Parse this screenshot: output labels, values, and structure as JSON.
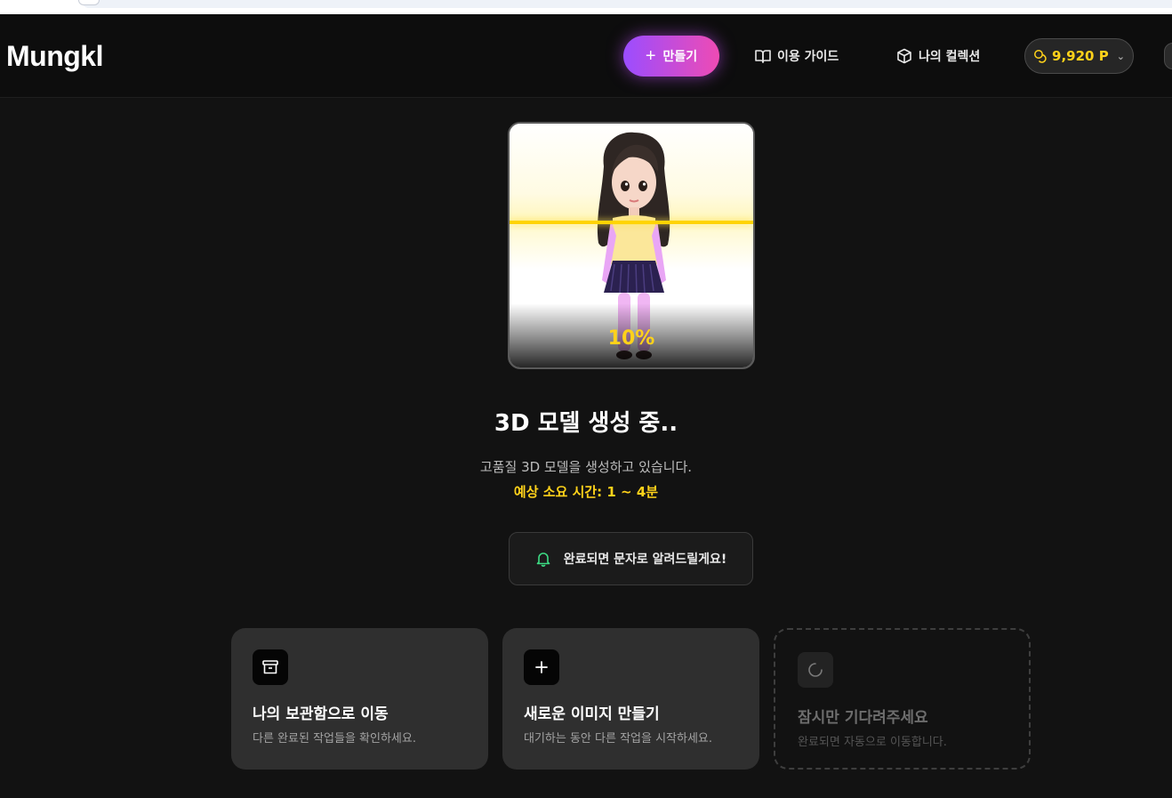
{
  "header": {
    "logo": "Mungkl",
    "create_label": "만들기",
    "guide_label": "이용 가이드",
    "collection_label": "나의 컬렉션",
    "points_label": "9,920 P",
    "icons": {
      "create": "plus-icon",
      "guide": "book-open-icon",
      "collection": "box-icon",
      "points": "coins-icon",
      "dropdown": "chevron-down-icon"
    }
  },
  "preview": {
    "progress_text": "10%",
    "progress_fraction": 0.1
  },
  "status": {
    "title": "3D 모델 생성 중..",
    "subtitle": "고품질 3D 모델을 생성하고 있습니다.",
    "eta": "예상 소요 시간: 1 ~ 4분"
  },
  "notify": {
    "text": "완료되면 문자로 알려드릴게요!",
    "icon": "bell-icon"
  },
  "cards": [
    {
      "title": "나의 보관함으로 이동",
      "desc": "다른 완료된 작업들을 확인하세요.",
      "icon": "archive-icon"
    },
    {
      "title": "새로운 이미지 만들기",
      "desc": "대기하는 동안 다른 작업을 시작하세요.",
      "icon": "plus-icon"
    },
    {
      "title": "잠시만 기다려주세요",
      "desc": "완료되면 자동으로 이동합니다.",
      "icon": "spinner-icon"
    }
  ],
  "colors": {
    "background": "#121212",
    "accent_yellow": "#ffd21a",
    "gradient_start": "#9b4dff",
    "gradient_end": "#ee4bb4",
    "bell_green": "#3ddc84"
  }
}
